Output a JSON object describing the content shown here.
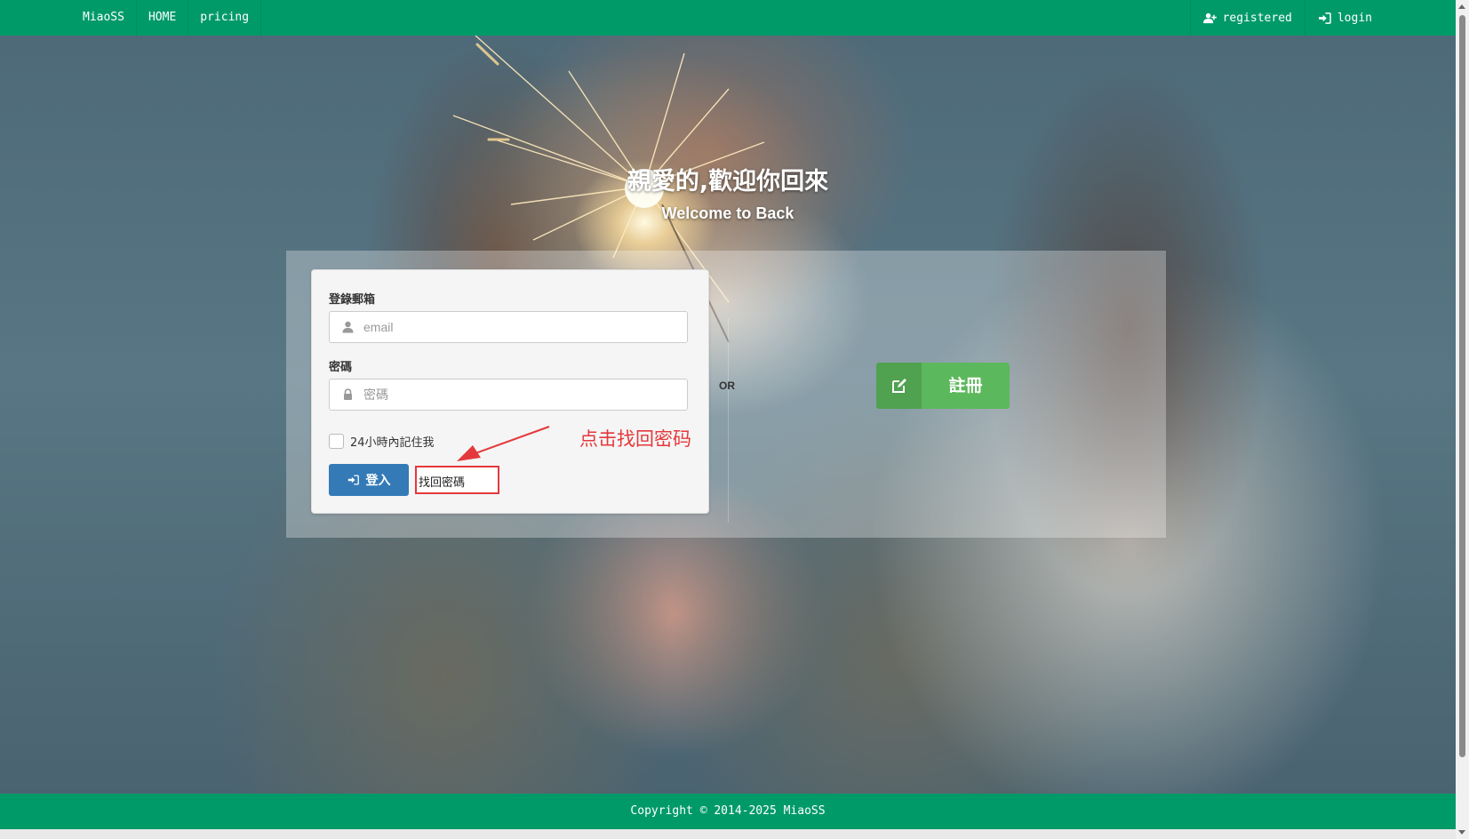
{
  "nav": {
    "brand": "MiaoSS",
    "home": "HOME",
    "pricing": "pricing",
    "registered": "registered",
    "login": "login"
  },
  "hero": {
    "title": "親愛的,歡迎你回來",
    "subtitle": "Welcome to Back"
  },
  "login_form": {
    "email_label": "登錄郵箱",
    "email_placeholder": "email",
    "password_label": "密碼",
    "password_placeholder": "密碼",
    "remember_label": "24小時內記住我",
    "remember_checked": false,
    "login_button": "登入",
    "forgot_password": "找回密碼"
  },
  "separator": "OR",
  "register_button": "註冊",
  "annotation": "点击找回密码",
  "footer": "Copyright © 2014-2025 MiaoSS",
  "colors": {
    "nav_green": "#009a69",
    "login_blue": "#337ab7",
    "register_green": "#5cb85c",
    "annotation_red": "#e4393c"
  },
  "icons": {
    "registered": "user-plus-icon",
    "login": "sign-in-icon",
    "email": "user-icon",
    "password": "lock-icon",
    "register": "edit-icon"
  }
}
